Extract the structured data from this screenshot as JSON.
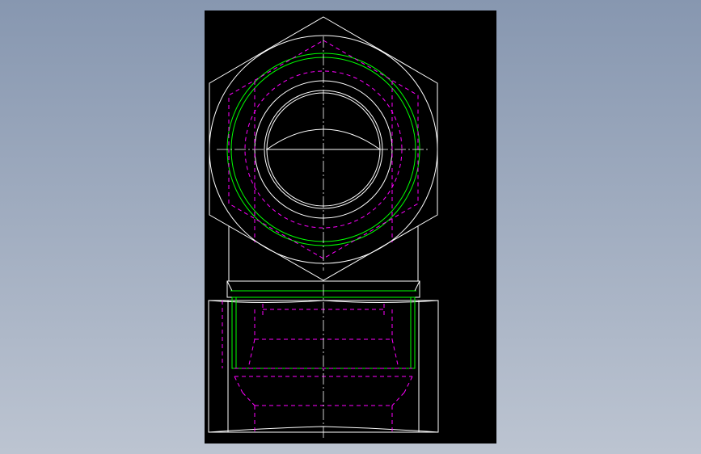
{
  "app": {
    "view": "cad-drawing-view"
  },
  "colors": {
    "background_top": "#8797b0",
    "background_bottom": "#bcc4d1",
    "sheet": "#000000",
    "outline": "#ffffff",
    "hidden": "#ff00ff",
    "thread": "#00ff00"
  },
  "drawing": {
    "top_view": "hex-nut-elbow-top-view",
    "front_view": "hex-nut-elbow-front-view"
  }
}
